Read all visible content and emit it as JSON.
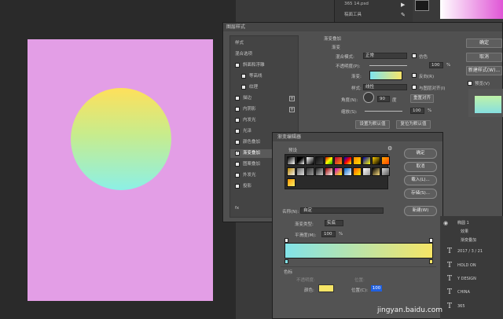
{
  "top": {
    "file_name": "365 14.psd",
    "layer_label": "稿面工具"
  },
  "layer_style": {
    "title": "图层样式",
    "left_panel": {
      "items": [
        {
          "label": "样式",
          "checkbox": false,
          "plus": false,
          "selected": false
        },
        {
          "label": "混合选项",
          "checkbox": false,
          "plus": false,
          "selected": false
        },
        {
          "label": "斜面和浮雕",
          "checkbox": true,
          "checked": false,
          "plus": false,
          "selected": false
        },
        {
          "label": "等高线",
          "checkbox": true,
          "checked": false,
          "plus": false,
          "selected": false,
          "indent": true
        },
        {
          "label": "纹理",
          "checkbox": true,
          "checked": false,
          "plus": false,
          "selected": false,
          "indent": true
        },
        {
          "label": "描边",
          "checkbox": true,
          "checked": false,
          "plus": true,
          "selected": false
        },
        {
          "label": "内阴影",
          "checkbox": true,
          "checked": false,
          "plus": true,
          "selected": false
        },
        {
          "label": "内发光",
          "checkbox": true,
          "checked": false,
          "plus": false,
          "selected": false
        },
        {
          "label": "光泽",
          "checkbox": true,
          "checked": false,
          "plus": false,
          "selected": false
        },
        {
          "label": "颜色叠加",
          "checkbox": true,
          "checked": false,
          "plus": true,
          "selected": false
        },
        {
          "label": "渐变叠加",
          "checkbox": true,
          "checked": true,
          "plus": true,
          "selected": true
        },
        {
          "label": "图案叠加",
          "checkbox": true,
          "checked": false,
          "plus": false,
          "selected": false
        },
        {
          "label": "外发光",
          "checkbox": true,
          "checked": false,
          "plus": false,
          "selected": false
        },
        {
          "label": "投影",
          "checkbox": true,
          "checked": false,
          "plus": true,
          "selected": false
        }
      ],
      "footer": "fx"
    },
    "gradient_overlay": {
      "section_title": "渐变叠加",
      "group_title": "渐变",
      "blend_mode_label": "混合模式:",
      "blend_mode_value": "正常",
      "dither_label": "仿色",
      "opacity_label": "不透明度(P):",
      "opacity_value": "100",
      "opacity_unit": "%",
      "gradient_label": "渐变:",
      "reverse_label": "反向(R)",
      "style_label": "样式:",
      "style_value": "线性",
      "align_label": "与图层对齐(I)",
      "angle_label": "角度(N):",
      "angle_value": "90",
      "angle_unit": "度",
      "reset_align_label": "重置对齐",
      "scale_label": "缩放(S):",
      "scale_value": "100",
      "scale_unit": "%",
      "set_default": "设置为默认值",
      "reset_default": "复位为默认值"
    },
    "right_buttons": {
      "ok": "确定",
      "cancel": "取消",
      "new_style": "新建样式(W)...",
      "preview": "预览(V)"
    }
  },
  "gradient_editor": {
    "title": "渐变编辑器",
    "presets_label": "预设",
    "ok": "确定",
    "cancel": "取消",
    "load": "载入(L)...",
    "save": "存储(S)...",
    "name_label": "名称(N):",
    "name_value": "自定",
    "new_button": "新建(W)",
    "type_label": "渐变类型:",
    "type_value": "实底",
    "smooth_label": "平滑度(M):",
    "smooth_value": "100",
    "smooth_unit": "%",
    "stops_label": "色标",
    "opacity_label": "不透明度:",
    "location_label_1": "位置:",
    "color_label": "颜色:",
    "location_label": "位置(C):",
    "location_value": "100",
    "colors": {
      "start": "#82e3e9",
      "end": "#f6e566"
    }
  },
  "layers": {
    "rows": [
      {
        "type": "layer",
        "label": "椭圆 1"
      },
      {
        "type": "effect",
        "label": "效果"
      },
      {
        "type": "effect",
        "label": "渐变叠加"
      },
      {
        "type": "text",
        "label": "2017 / 3 / 21"
      },
      {
        "type": "text",
        "label": "HOLD ON"
      },
      {
        "type": "text",
        "label": "Y DESIGN"
      },
      {
        "type": "text",
        "label": "CHINA"
      },
      {
        "type": "text",
        "label": "365"
      }
    ]
  },
  "watermark": "jingyan.baidu.com",
  "canvas": {
    "bg_color": "#e39ee6",
    "circle_top_color": "#fee05b",
    "circle_bottom_color": "#8cf0e6"
  }
}
